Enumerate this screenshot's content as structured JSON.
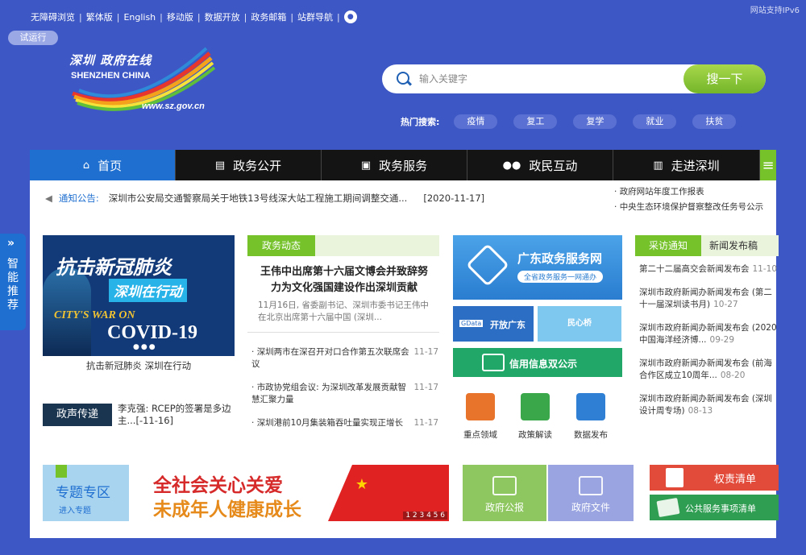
{
  "toplinks": {
    "items": [
      "无障碍浏览",
      "繁体版",
      "English",
      "移动版",
      "数据开放",
      "政务邮箱",
      "站群导航"
    ],
    "separator": "|"
  },
  "ipv6_label": "网站支持IPv6",
  "trial_badge": "试运行",
  "logo": {
    "cn": "深圳 政府在线",
    "en": "SHENZHEN CHINA",
    "url": "www.sz.gov.cn"
  },
  "search": {
    "placeholder": "输入关键字",
    "button": "搜一下",
    "hot_label": "热门搜索:",
    "hot_tags": [
      "疫情",
      "复工",
      "复学",
      "就业",
      "扶贫"
    ]
  },
  "nav": {
    "items": [
      {
        "label": "首页",
        "icon": "home-icon"
      },
      {
        "label": "政务公开",
        "icon": "news-icon"
      },
      {
        "label": "政务服务",
        "icon": "monitor-icon"
      },
      {
        "label": "政民互动",
        "icon": "people-icon"
      },
      {
        "label": "走进深圳",
        "icon": "building-icon"
      }
    ]
  },
  "notice": {
    "label": "通知公告:",
    "text": "深圳市公安局交通警察局关于地铁13号线深大站工程施工期间调整交通...",
    "date": "[2020-11-17]"
  },
  "right_links": [
    "政府网站年度工作报表",
    "中央生态环境保护督察整改任务号公示"
  ],
  "smart_recommend": {
    "arrow": "»",
    "text": "智能推荐"
  },
  "banner": {
    "title1": "抗击新冠肺炎",
    "title2": "深圳在行动",
    "title3": "CITY'S WAR ON",
    "title4": "COVID-19",
    "dots": "●●●",
    "caption": "抗击新冠肺炎 深圳在行动"
  },
  "voice": {
    "label": "政声传递",
    "text": "李克强: RCEP的签署是多边主...[-11-16]"
  },
  "zhengwu": {
    "tab": "政务动态",
    "headline": "王伟中出席第十六届文博会并致辞努力为文化强国建设作出深圳贡献",
    "summary": "11月16日, 省委副书记、深圳市委书记王伟中在北京出席第十六届中国 (深圳...",
    "list": [
      {
        "text": "深圳两市在深召开对口合作第五次联席会议",
        "date": "11-17"
      },
      {
        "text": "市政协党组会议: 为深圳改革发展贡献智慧汇聚力量",
        "date": "11-17"
      },
      {
        "text": "深圳港前10月集装箱吞吐量实现正增长",
        "date": "11-17"
      }
    ]
  },
  "services": {
    "gd_title": "广东政务服务网",
    "gd_sub": "全省政务服务一网通办",
    "open_badge": "GData",
    "open_title": "开放广东",
    "minsheng": "民心桥",
    "credit": "信用信息双公示",
    "quick": [
      "重点领域",
      "政策解读",
      "数据发布"
    ]
  },
  "caifang": {
    "tab_active": "采访通知",
    "tab_other": "新闻发布稿",
    "list": [
      {
        "text": "第二十二届高交会新闻发布会",
        "date": "11-10"
      },
      {
        "text": "深圳市政府新闻办新闻发布会 (第二十一届深圳读书月)",
        "date": "10-27"
      },
      {
        "text": "深圳市政府新闻办新闻发布会 (2020中国海洋经济博...",
        "date": "09-29"
      },
      {
        "text": "深圳市政府新闻办新闻发布会 (前海合作区成立10周年...",
        "date": "08-20"
      },
      {
        "text": "深圳市政府新闻办新闻发布会 (深圳设计周专场)",
        "date": "08-13"
      }
    ]
  },
  "bottom": {
    "topic_title": "专题专区",
    "topic_sub": "进入专题",
    "care1": "全社会关心关爱",
    "care2": "未成年人健康成长",
    "care_pager": "1 2 3 4 5 6",
    "gov_bulletin": "政府公报",
    "gov_docs": "政府文件",
    "quanze": "权责清单",
    "gonggong": "公共服务事项清单"
  }
}
